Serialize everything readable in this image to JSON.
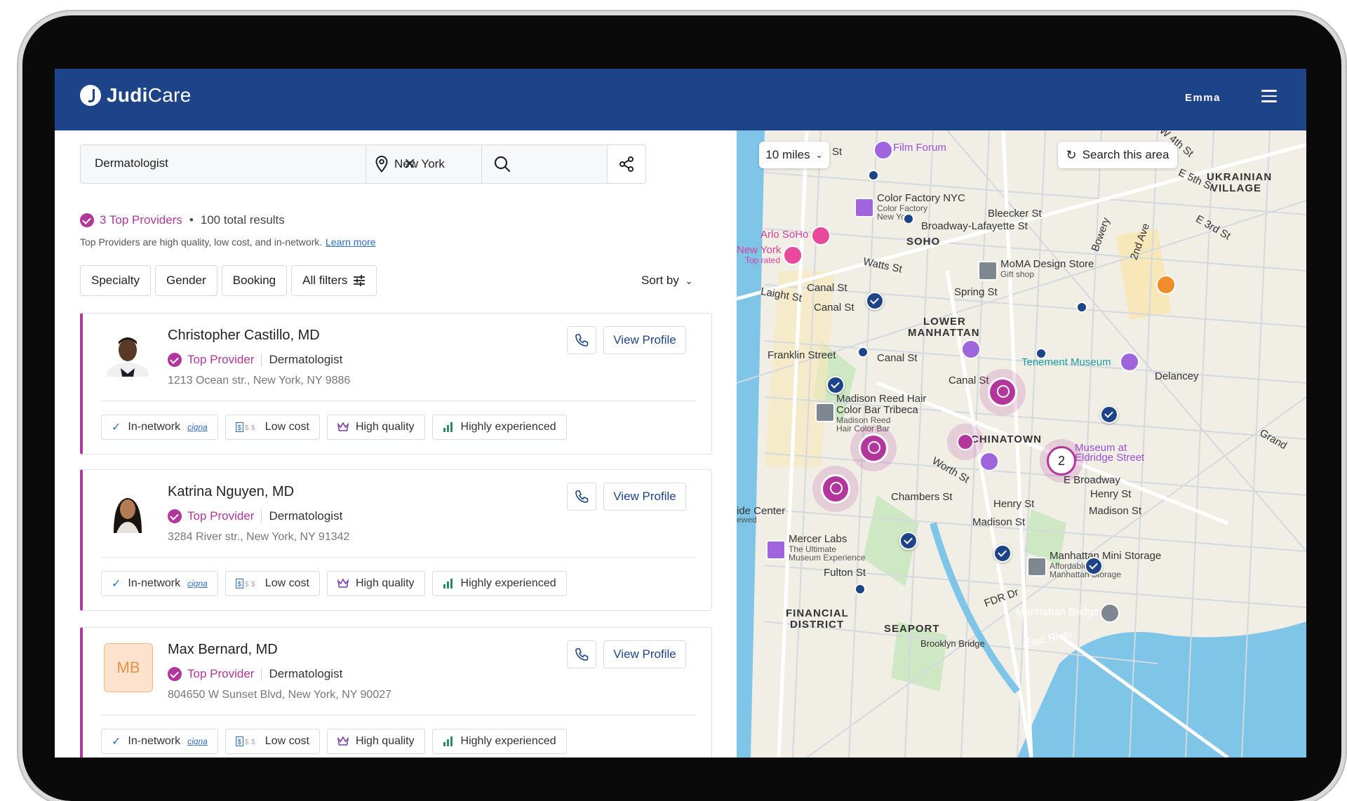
{
  "app": {
    "brand_bold": "Judi",
    "brand_light": "Care",
    "user": "Emma"
  },
  "search": {
    "query": "Dermatologist",
    "location": "New York"
  },
  "summary": {
    "top_count": "3 Top Providers",
    "bullet": "•",
    "total": "100 total results",
    "note": "Top Providers are high quality, low cost, and in-network.",
    "learn_more": "Learn more"
  },
  "filters": [
    "Specialty",
    "Gender",
    "Booking",
    "All filters"
  ],
  "sort_label": "Sort by",
  "providers": [
    {
      "name": "Christopher Castillo, MD",
      "badge": "Top Provider",
      "specialty": "Dermatologist",
      "address": "1213 Ocean str., New York, NY 9886",
      "initials": ""
    },
    {
      "name": "Katrina Nguyen, MD",
      "badge": "Top Provider",
      "specialty": "Dermatologist",
      "address": "3284 River str., New York, NY 91342",
      "initials": ""
    },
    {
      "name": "Max Bernard, MD",
      "badge": "Top Provider",
      "specialty": "Dermatologist",
      "address": "804650 W Sunset Blvd, New York, NY 90027",
      "initials": "MB"
    }
  ],
  "card_actions": {
    "view_profile": "View Profile"
  },
  "tags": {
    "in_network": "In-network",
    "insurer": "cigna",
    "low_cost": "Low cost",
    "high_quality": "High quality",
    "experienced": "Highly experienced"
  },
  "map": {
    "radius": "10 miles",
    "search_area": "Search this area",
    "cluster_count": "2",
    "labels": {
      "film_forum": "Film Forum",
      "ukrainian": "UKRAINIAN",
      "village": "VILLAGE",
      "color_factory": "Color Factory NYC",
      "color_factory_sub1": "Color Factory",
      "color_factory_sub2": "New Yo",
      "bleecker": "Bleecker St",
      "broadway_lafayette": "Broadway-Lafayette St",
      "soho": "SOHO",
      "arlo": "Arlo SoHo",
      "newyork_hotel": "New York",
      "top_rated": "Top rated",
      "moma": "MoMA Design Store",
      "gift_shop": "Gift shop",
      "watts": "Watts St",
      "canal_st_1": "Canal St",
      "canal_st_2": "Canal St",
      "spring": "Spring St",
      "laight": "Laight St",
      "lower": "LOWER",
      "manhattan": "MANHATTAN",
      "franklin": "Franklin Street",
      "canal_st_3": "Canal St",
      "tenement": "Tenement Museum",
      "delancey": "Delancey",
      "canal_st_4": "Canal St",
      "madison_reed": "Madison Reed Hair",
      "color_bar": "Color Bar Tribeca",
      "mr_sub1": "Madison Reed",
      "mr_sub2": "Hair Color Bar",
      "chinatown": "CHINATOWN",
      "museum_eldridge1": "Museum at",
      "museum_eldridge2": "Eldridge Street",
      "e_broadway": "E Broadway",
      "henry": "Henry St",
      "madison_st": "Madison St",
      "chambers": "Chambers St",
      "worth": "Worth St",
      "mercer": "Mercer Labs",
      "mercer_sub1": "The Ultimate",
      "mercer_sub2": "Museum Experience",
      "fulton": "Fulton St",
      "manhattan_storage": "Manhattan Mini Storage",
      "ms_sub1": "Affordable",
      "ms_sub2": "Manhattan Storage",
      "financial": "FINANCIAL",
      "district": "DISTRICT",
      "seaport": "SEAPORT",
      "manhattan_bridge": "Manhattan Bridge",
      "east_river": "East River",
      "brooklyn_bridge": "Brooklyn Bridge",
      "fdr": "FDR Dr",
      "side_center": "ide Center",
      "side_center2": "ewed",
      "w4th": "W 4th St",
      "e5th": "E 5th St",
      "e3rd": "E 3rd St",
      "bowery": "Bowery",
      "second_ave": "2nd Ave",
      "grand": "Grand",
      "st_top": "St"
    }
  },
  "colors": {
    "brand": "#1d4489",
    "accent": "#b2369b",
    "link": "#2b6cc2"
  }
}
